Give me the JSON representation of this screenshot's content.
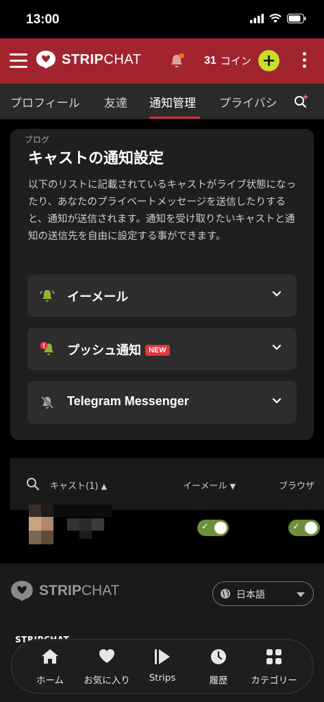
{
  "status": {
    "time": "13:00"
  },
  "header": {
    "logo_strip": "STRIP",
    "logo_chat": "CHAT",
    "coins_count": "31",
    "coins_label": "コイン",
    "plus": "+"
  },
  "tabs": [
    {
      "label": "プロフィール"
    },
    {
      "label": "友達"
    },
    {
      "label": "通知管理"
    },
    {
      "label": "プライバシ"
    }
  ],
  "card": {
    "title": "キャストの通知設定",
    "description": "以下のリストに記載されているキャストがライブ状態になったり、あなたのプライベートメッセージを送信したりすると、通知が送信されます。通知を受け取りたいキャストと通知の送信先を自由に設定する事ができます。",
    "options": [
      {
        "label": "イーメール"
      },
      {
        "label": "プッシュ通知",
        "badge": "NEW"
      },
      {
        "label": "Telegram Messenger"
      }
    ]
  },
  "table": {
    "col_cast": "キャスト(1)",
    "col_email": "イーメール",
    "col_browser": "ブラウザ"
  },
  "footer": {
    "logo_strip": "STRIP",
    "logo_chat": "CHAT",
    "language": "日本語",
    "section_title": "STRIPCHAT",
    "blog": "ブログ"
  },
  "bottom_nav": [
    {
      "label": "ホーム",
      "icon": "home-icon"
    },
    {
      "label": "お気に入り",
      "icon": "heart-icon"
    },
    {
      "label": "Strips",
      "icon": "play-icon"
    },
    {
      "label": "履歴",
      "icon": "clock-icon"
    },
    {
      "label": "カテゴリー",
      "icon": "grid-icon"
    }
  ],
  "colors": {
    "header_bg": "#a2242f",
    "accent_red": "#d52b3a",
    "coin_green": "#c8dc2a",
    "toggle_green": "#6d8f3a"
  }
}
